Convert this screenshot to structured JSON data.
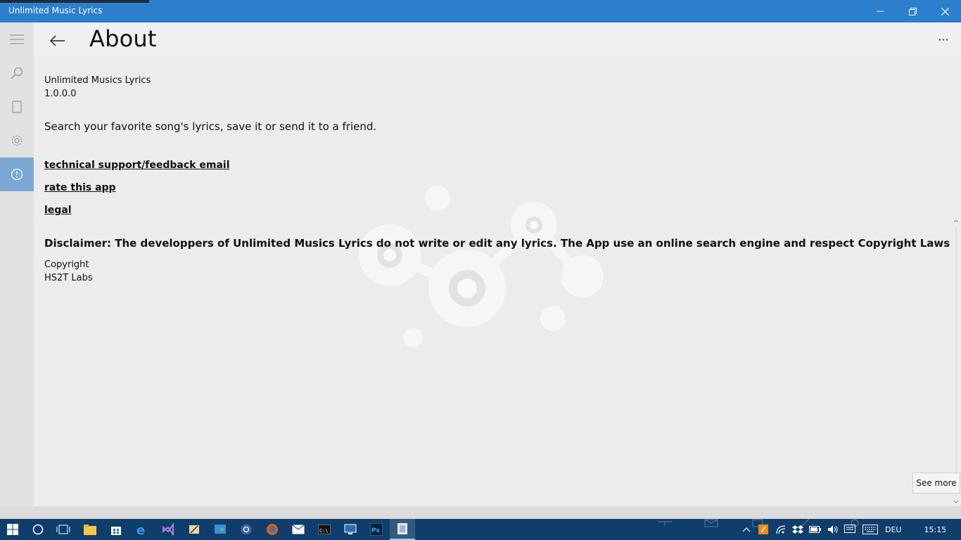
{
  "window": {
    "title": "Unlimited Music Lyrics"
  },
  "header": {
    "title": "About",
    "more_label": "···"
  },
  "about": {
    "app_name": "Unlimited Musics Lyrics",
    "version": "1.0.0.0",
    "description": "Search your favorite song's lyrics, save it or send it to a friend.",
    "links": [
      "technical support/feedback email",
      "rate this app",
      "legal"
    ],
    "disclaimer": "Disclaimer: The developpers of Unlimited Musics Lyrics do not write or edit any lyrics. The App use an online search engine and respect Copyright Laws",
    "copyright_label": "Copyright",
    "company": "HS2T Labs"
  },
  "see_more_label": "See more",
  "nav": {
    "items": [
      "hamburger-menu",
      "search",
      "lyrics-page",
      "settings",
      "about"
    ],
    "active": "about"
  },
  "taskbar": {
    "language": "DEU",
    "time": "15:15",
    "apps": [
      "start",
      "cortana",
      "task-view",
      "file-explorer",
      "store",
      "edge",
      "visual-studio",
      "tool",
      "media",
      "app",
      "firefox",
      "mail",
      "cmd",
      "remote",
      "photoshop",
      "lyrics-app"
    ]
  },
  "colors": {
    "titlebar": "#2b7fcd",
    "nav_active": "#7aa8d3",
    "taskbar": "#0f3e6c"
  }
}
